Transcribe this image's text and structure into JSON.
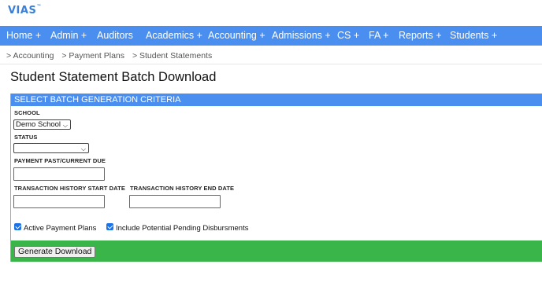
{
  "app": {
    "logo": "VIAS",
    "logo_mark": "™"
  },
  "nav": [
    {
      "id": "home",
      "label": "Home +"
    },
    {
      "id": "admin",
      "label": "Admin +"
    },
    {
      "id": "auditors",
      "label": "Auditors"
    },
    {
      "id": "academics",
      "label": "Academics +"
    },
    {
      "id": "accounting",
      "label": "Accounting +"
    },
    {
      "id": "admissions",
      "label": "Admissions +"
    },
    {
      "id": "cs",
      "label": "CS +"
    },
    {
      "id": "fa",
      "label": "FA +"
    },
    {
      "id": "reports",
      "label": "Reports +"
    },
    {
      "id": "students",
      "label": "Students +"
    }
  ],
  "breadcrumb": [
    "> Accounting",
    "> Payment Plans",
    "> Student Statements"
  ],
  "page_title": "Student Statement Batch Download",
  "panel": {
    "header": "SELECT BATCH GENERATION CRITERIA",
    "school_label": "SCHOOL",
    "school_value": "Demo School",
    "status_label": "STATUS",
    "status_value": "",
    "payment_due_label": "PAYMENT PAST/CURRENT DUE",
    "payment_due_value": "",
    "start_date_label": "TRANSACTION HISTORY START DATE",
    "start_date_value": "",
    "end_date_label": "TRANSACTION HISTORY END DATE",
    "end_date_value": "",
    "active_plans_label": "Active Payment Plans",
    "active_plans_checked": true,
    "pending_disb_label": "Include Potential Pending Disbursments",
    "pending_disb_checked": true,
    "generate_label": "Generate Download"
  },
  "colors": {
    "nav": "#4a8fef",
    "footer": "#39b54a",
    "logo": "#3a7fd6"
  }
}
